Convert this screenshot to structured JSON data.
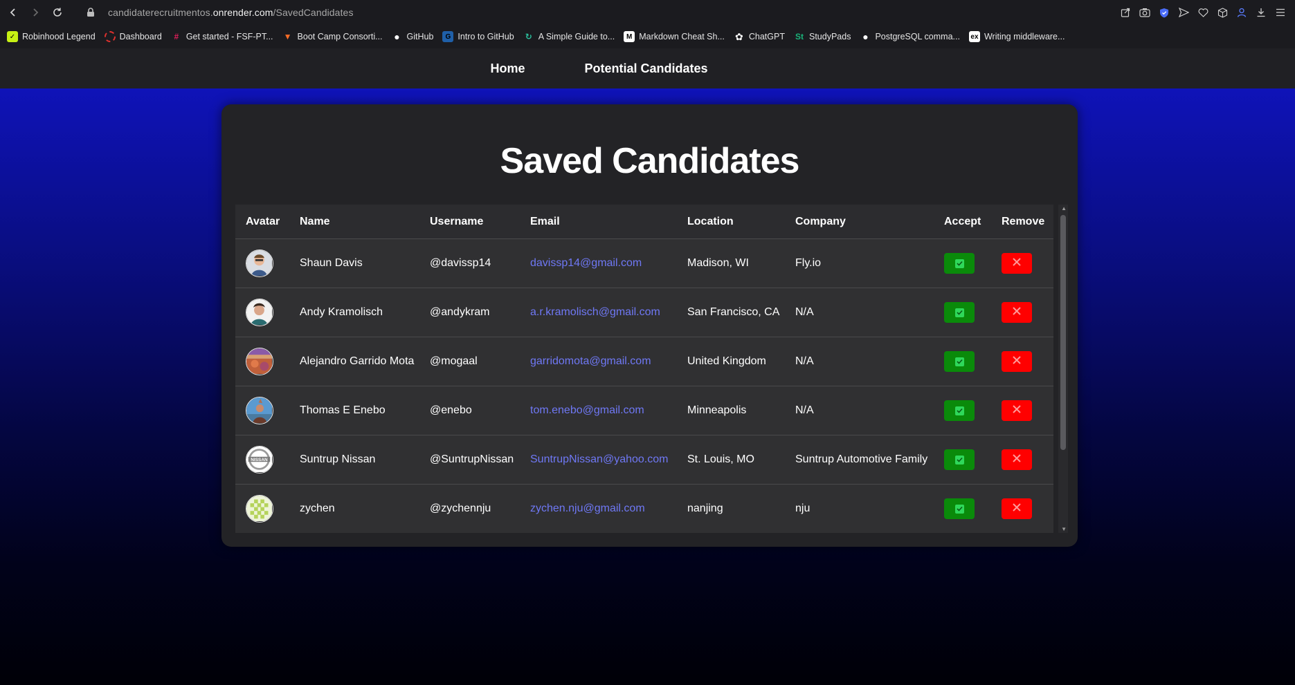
{
  "browser": {
    "url_prefix": "candidaterecruitmentos.",
    "url_host": "onrender.com",
    "url_path": "/SavedCandidates",
    "bookmarks": [
      {
        "label": "Robinhood Legend",
        "icon": "robinhood-icon",
        "color": "#c6f014"
      },
      {
        "label": "Dashboard",
        "icon": "dashboard-icon",
        "color": "#e0312e"
      },
      {
        "label": "Get started - FSF-PT...",
        "icon": "slack-icon",
        "color": "#e01e5a"
      },
      {
        "label": "Boot Camp Consorti...",
        "icon": "gitlab-icon",
        "color": "#fc6d26"
      },
      {
        "label": "GitHub",
        "icon": "github-icon",
        "color": "#ffffff"
      },
      {
        "label": "Intro to GitHub",
        "icon": "gsa-icon",
        "color": "#1f5fa8"
      },
      {
        "label": "A Simple Guide to...",
        "icon": "guide-icon",
        "color": "#2bbf9d"
      },
      {
        "label": "Markdown Cheat Sh...",
        "icon": "markdown-icon",
        "color": "#ffffff"
      },
      {
        "label": "ChatGPT",
        "icon": "chatgpt-icon",
        "color": "#ffffff"
      },
      {
        "label": "StudyPads",
        "icon": "studypads-icon",
        "color": "#19b37a"
      },
      {
        "label": "PostgreSQL comma...",
        "icon": "github-icon",
        "color": "#ffffff"
      },
      {
        "label": "Writing middleware...",
        "icon": "express-icon",
        "color": "#ffffff"
      }
    ]
  },
  "nav": {
    "home": "Home",
    "potential": "Potential Candidates"
  },
  "page": {
    "title": "Saved Candidates"
  },
  "table": {
    "headers": [
      "Avatar",
      "Name",
      "Username",
      "Email",
      "Location",
      "Company",
      "Accept",
      "Remove"
    ],
    "rows": [
      {
        "name": "Shaun Davis",
        "username": "@davissp14",
        "email": "davissp14@gmail.com",
        "location": "Madison, WI",
        "company": "Fly.io",
        "avatar": "avatar-shaun"
      },
      {
        "name": "Andy Kramolisch",
        "username": "@andykram",
        "email": "a.r.kramolisch@gmail.com",
        "location": "San Francisco, CA",
        "company": "N/A",
        "avatar": "avatar-andy"
      },
      {
        "name": "Alejandro Garrido Mota",
        "username": "@mogaal",
        "email": "garridomota@gmail.com",
        "location": "United Kingdom",
        "company": "N/A",
        "avatar": "avatar-alejandro"
      },
      {
        "name": "Thomas E Enebo",
        "username": "@enebo",
        "email": "tom.enebo@gmail.com",
        "location": "Minneapolis",
        "company": "N/A",
        "avatar": "avatar-thomas"
      },
      {
        "name": "Suntrup Nissan",
        "username": "@SuntrupNissan",
        "email": "SuntrupNissan@yahoo.com",
        "location": "St. Louis, MO",
        "company": "Suntrup Automotive Family",
        "avatar": "avatar-nissan",
        "avatar_text": "NISSAN"
      },
      {
        "name": "zychen",
        "username": "@zychennju",
        "email": "zychen.nju@gmail.com",
        "location": "nanjing",
        "company": "nju",
        "avatar": "avatar-zychen"
      }
    ]
  },
  "colors": {
    "accept": "#0a8a0a",
    "remove": "#ff0000",
    "email": "#6f78f5"
  }
}
